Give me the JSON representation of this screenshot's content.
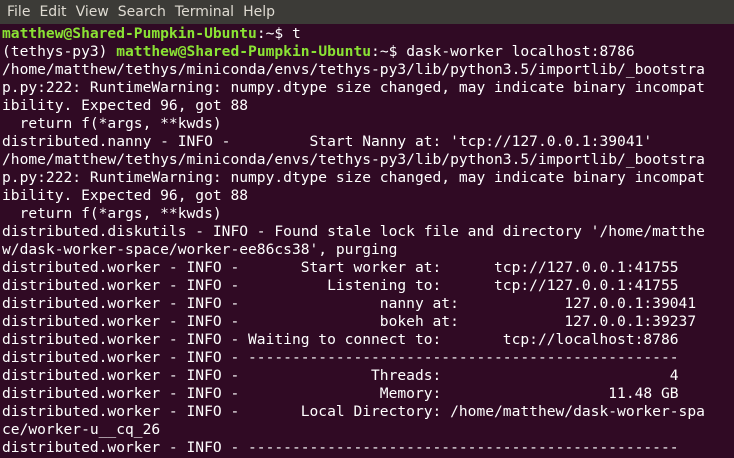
{
  "menubar": {
    "items": [
      "File",
      "Edit",
      "View",
      "Search",
      "Terminal",
      "Help"
    ]
  },
  "terminal": {
    "first_prompt": {
      "user_host": "matthew@Shared-Pumpkin-Ubuntu",
      "path_and_symbol": ":~$ ",
      "command": "t"
    },
    "second_prompt": {
      "env": "(tethys-py3) ",
      "user_host": "matthew@Shared-Pumpkin-Ubuntu",
      "path_and_symbol": ":~$ ",
      "command": "dask-worker localhost:8786"
    },
    "output_lines": [
      "/home/matthew/tethys/miniconda/envs/tethys-py3/lib/python3.5/importlib/_bootstra",
      "p.py:222: RuntimeWarning: numpy.dtype size changed, may indicate binary incompat",
      "ibility. Expected 96, got 88",
      "  return f(*args, **kwds)",
      "distributed.nanny - INFO -         Start Nanny at: 'tcp://127.0.0.1:39041'",
      "/home/matthew/tethys/miniconda/envs/tethys-py3/lib/python3.5/importlib/_bootstra",
      "p.py:222: RuntimeWarning: numpy.dtype size changed, may indicate binary incompat",
      "ibility. Expected 96, got 88",
      "  return f(*args, **kwds)",
      "distributed.diskutils - INFO - Found stale lock file and directory '/home/matthe",
      "w/dask-worker-space/worker-ee86cs38', purging",
      "distributed.worker - INFO -       Start worker at:      tcp://127.0.0.1:41755",
      "distributed.worker - INFO -          Listening to:      tcp://127.0.0.1:41755",
      "distributed.worker - INFO -                nanny at:            127.0.0.1:39041",
      "distributed.worker - INFO -                bokeh at:            127.0.0.1:39237",
      "distributed.worker - INFO - Waiting to connect to:       tcp://localhost:8786",
      "distributed.worker - INFO - -------------------------------------------------",
      "distributed.worker - INFO -               Threads:                          4",
      "distributed.worker - INFO -                Memory:                   11.48 GB",
      "distributed.worker - INFO -       Local Directory: /home/matthew/dask-worker-spa",
      "ce/worker-u__cq_26",
      "distributed.worker - INFO - -------------------------------------------------"
    ]
  }
}
